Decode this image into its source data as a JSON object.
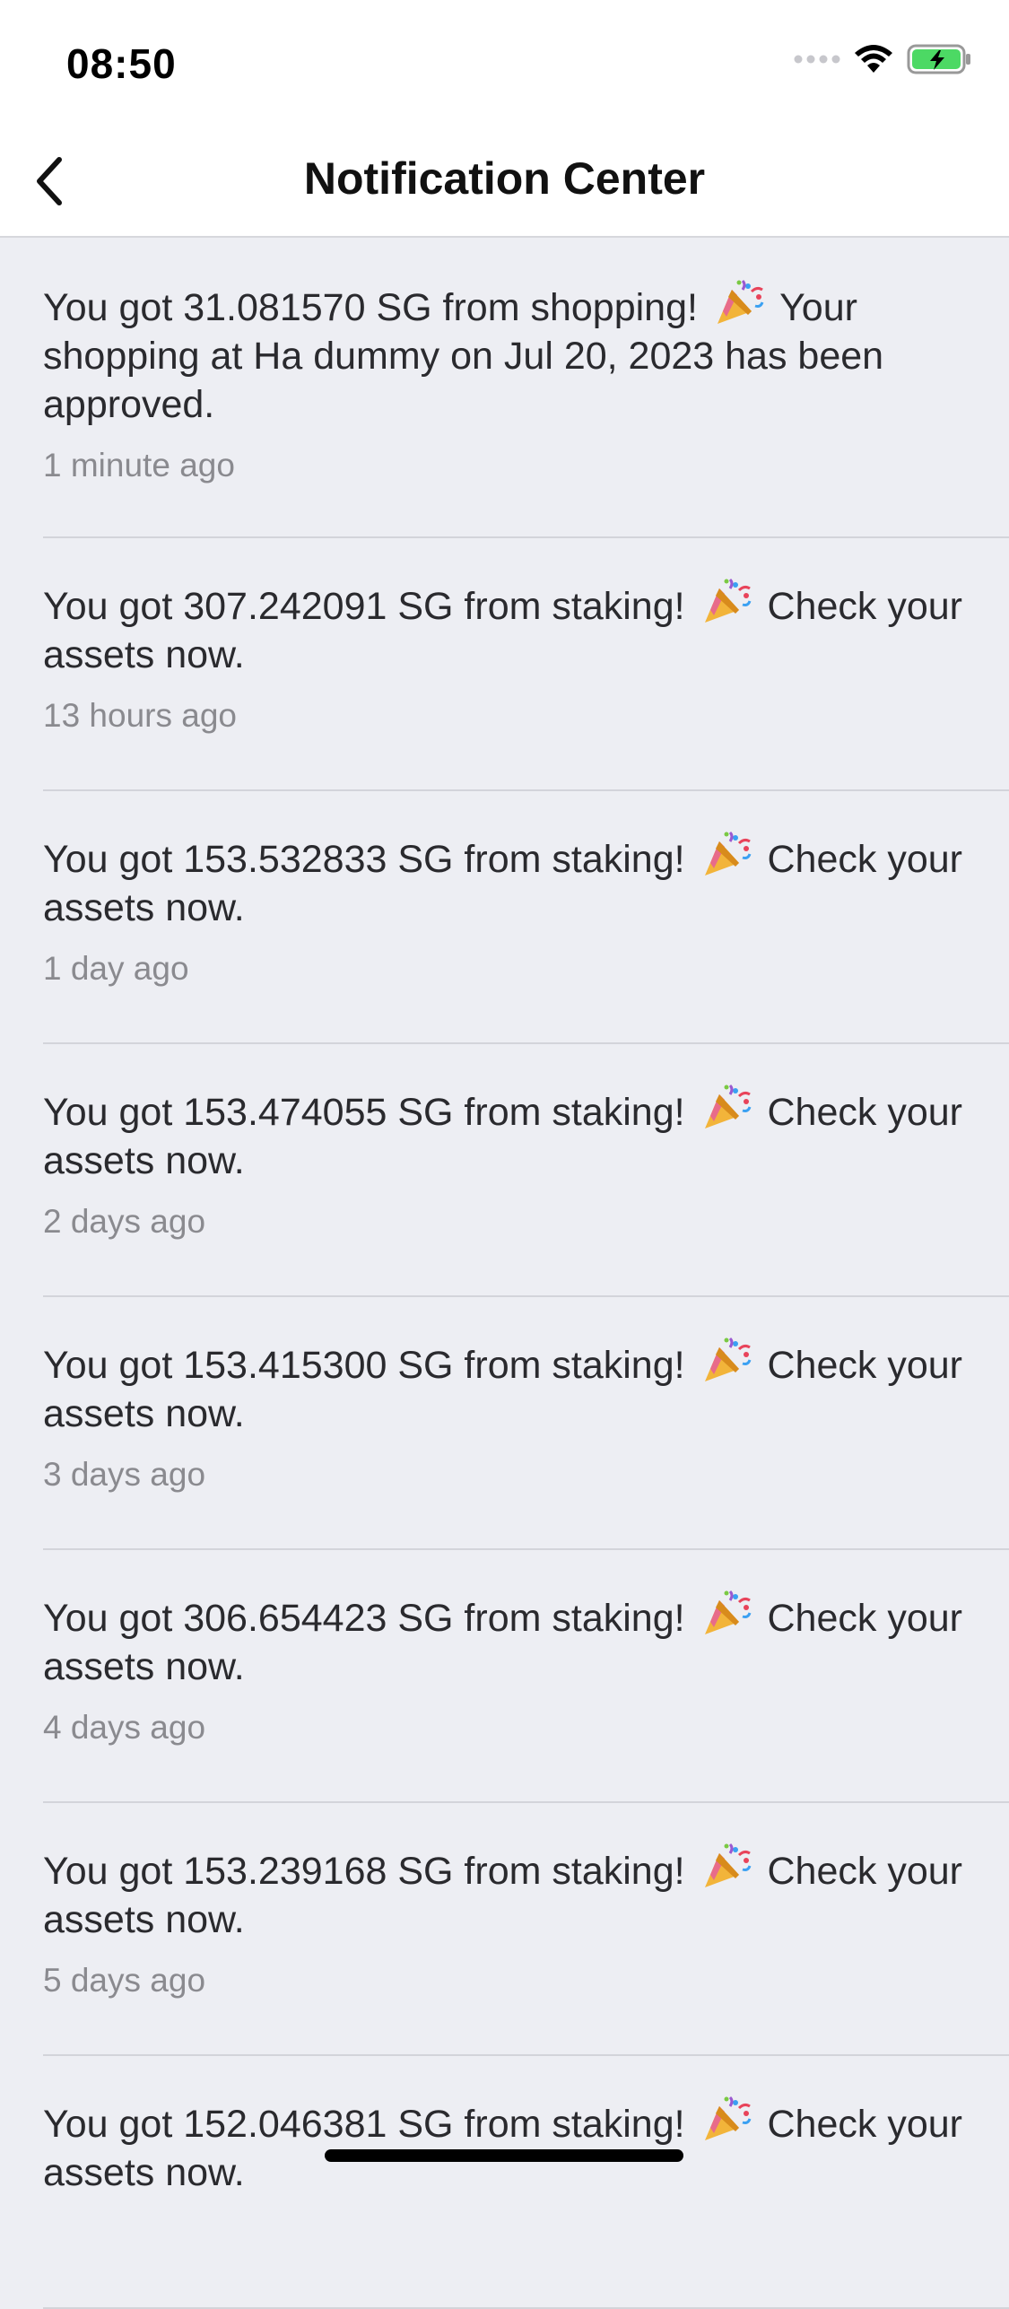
{
  "status_bar": {
    "time": "08:50",
    "icons": [
      "signal-dots-icon",
      "wifi-icon",
      "battery-charging-icon"
    ],
    "battery_color": "#4cd964"
  },
  "nav": {
    "title": "Notification Center",
    "back_icon": "chevron-left-icon"
  },
  "notifications": [
    {
      "text_before": "You got 31.081570 SG from shopping!",
      "emoji": "party-popper-icon",
      "text_after": "Your shopping at Ha dummy on Jul 20, 2023 has been approved.",
      "time": "1 minute ago"
    },
    {
      "text_before": "You got 307.242091 SG from staking!",
      "emoji": "party-popper-icon",
      "text_after": "Check your assets now.",
      "time": "13 hours ago"
    },
    {
      "text_before": "You got 153.532833 SG from staking!",
      "emoji": "party-popper-icon",
      "text_after": "Check your assets now.",
      "time": "1 day ago"
    },
    {
      "text_before": "You got 153.474055 SG from staking!",
      "emoji": "party-popper-icon",
      "text_after": "Check your assets now.",
      "time": "2 days ago"
    },
    {
      "text_before": "You got 153.415300 SG from staking!",
      "emoji": "party-popper-icon",
      "text_after": "Check your assets now.",
      "time": "3 days ago"
    },
    {
      "text_before": "You got 306.654423 SG from staking!",
      "emoji": "party-popper-icon",
      "text_after": "Check your assets now.",
      "time": "4 days ago"
    },
    {
      "text_before": "You got 153.239168 SG from staking!",
      "emoji": "party-popper-icon",
      "text_after": "Check your assets now.",
      "time": "5 days ago"
    },
    {
      "text_before": "You got 152.046381 SG from staking!",
      "emoji": "party-popper-icon",
      "text_after": "Check your assets now.",
      "time": ""
    }
  ]
}
